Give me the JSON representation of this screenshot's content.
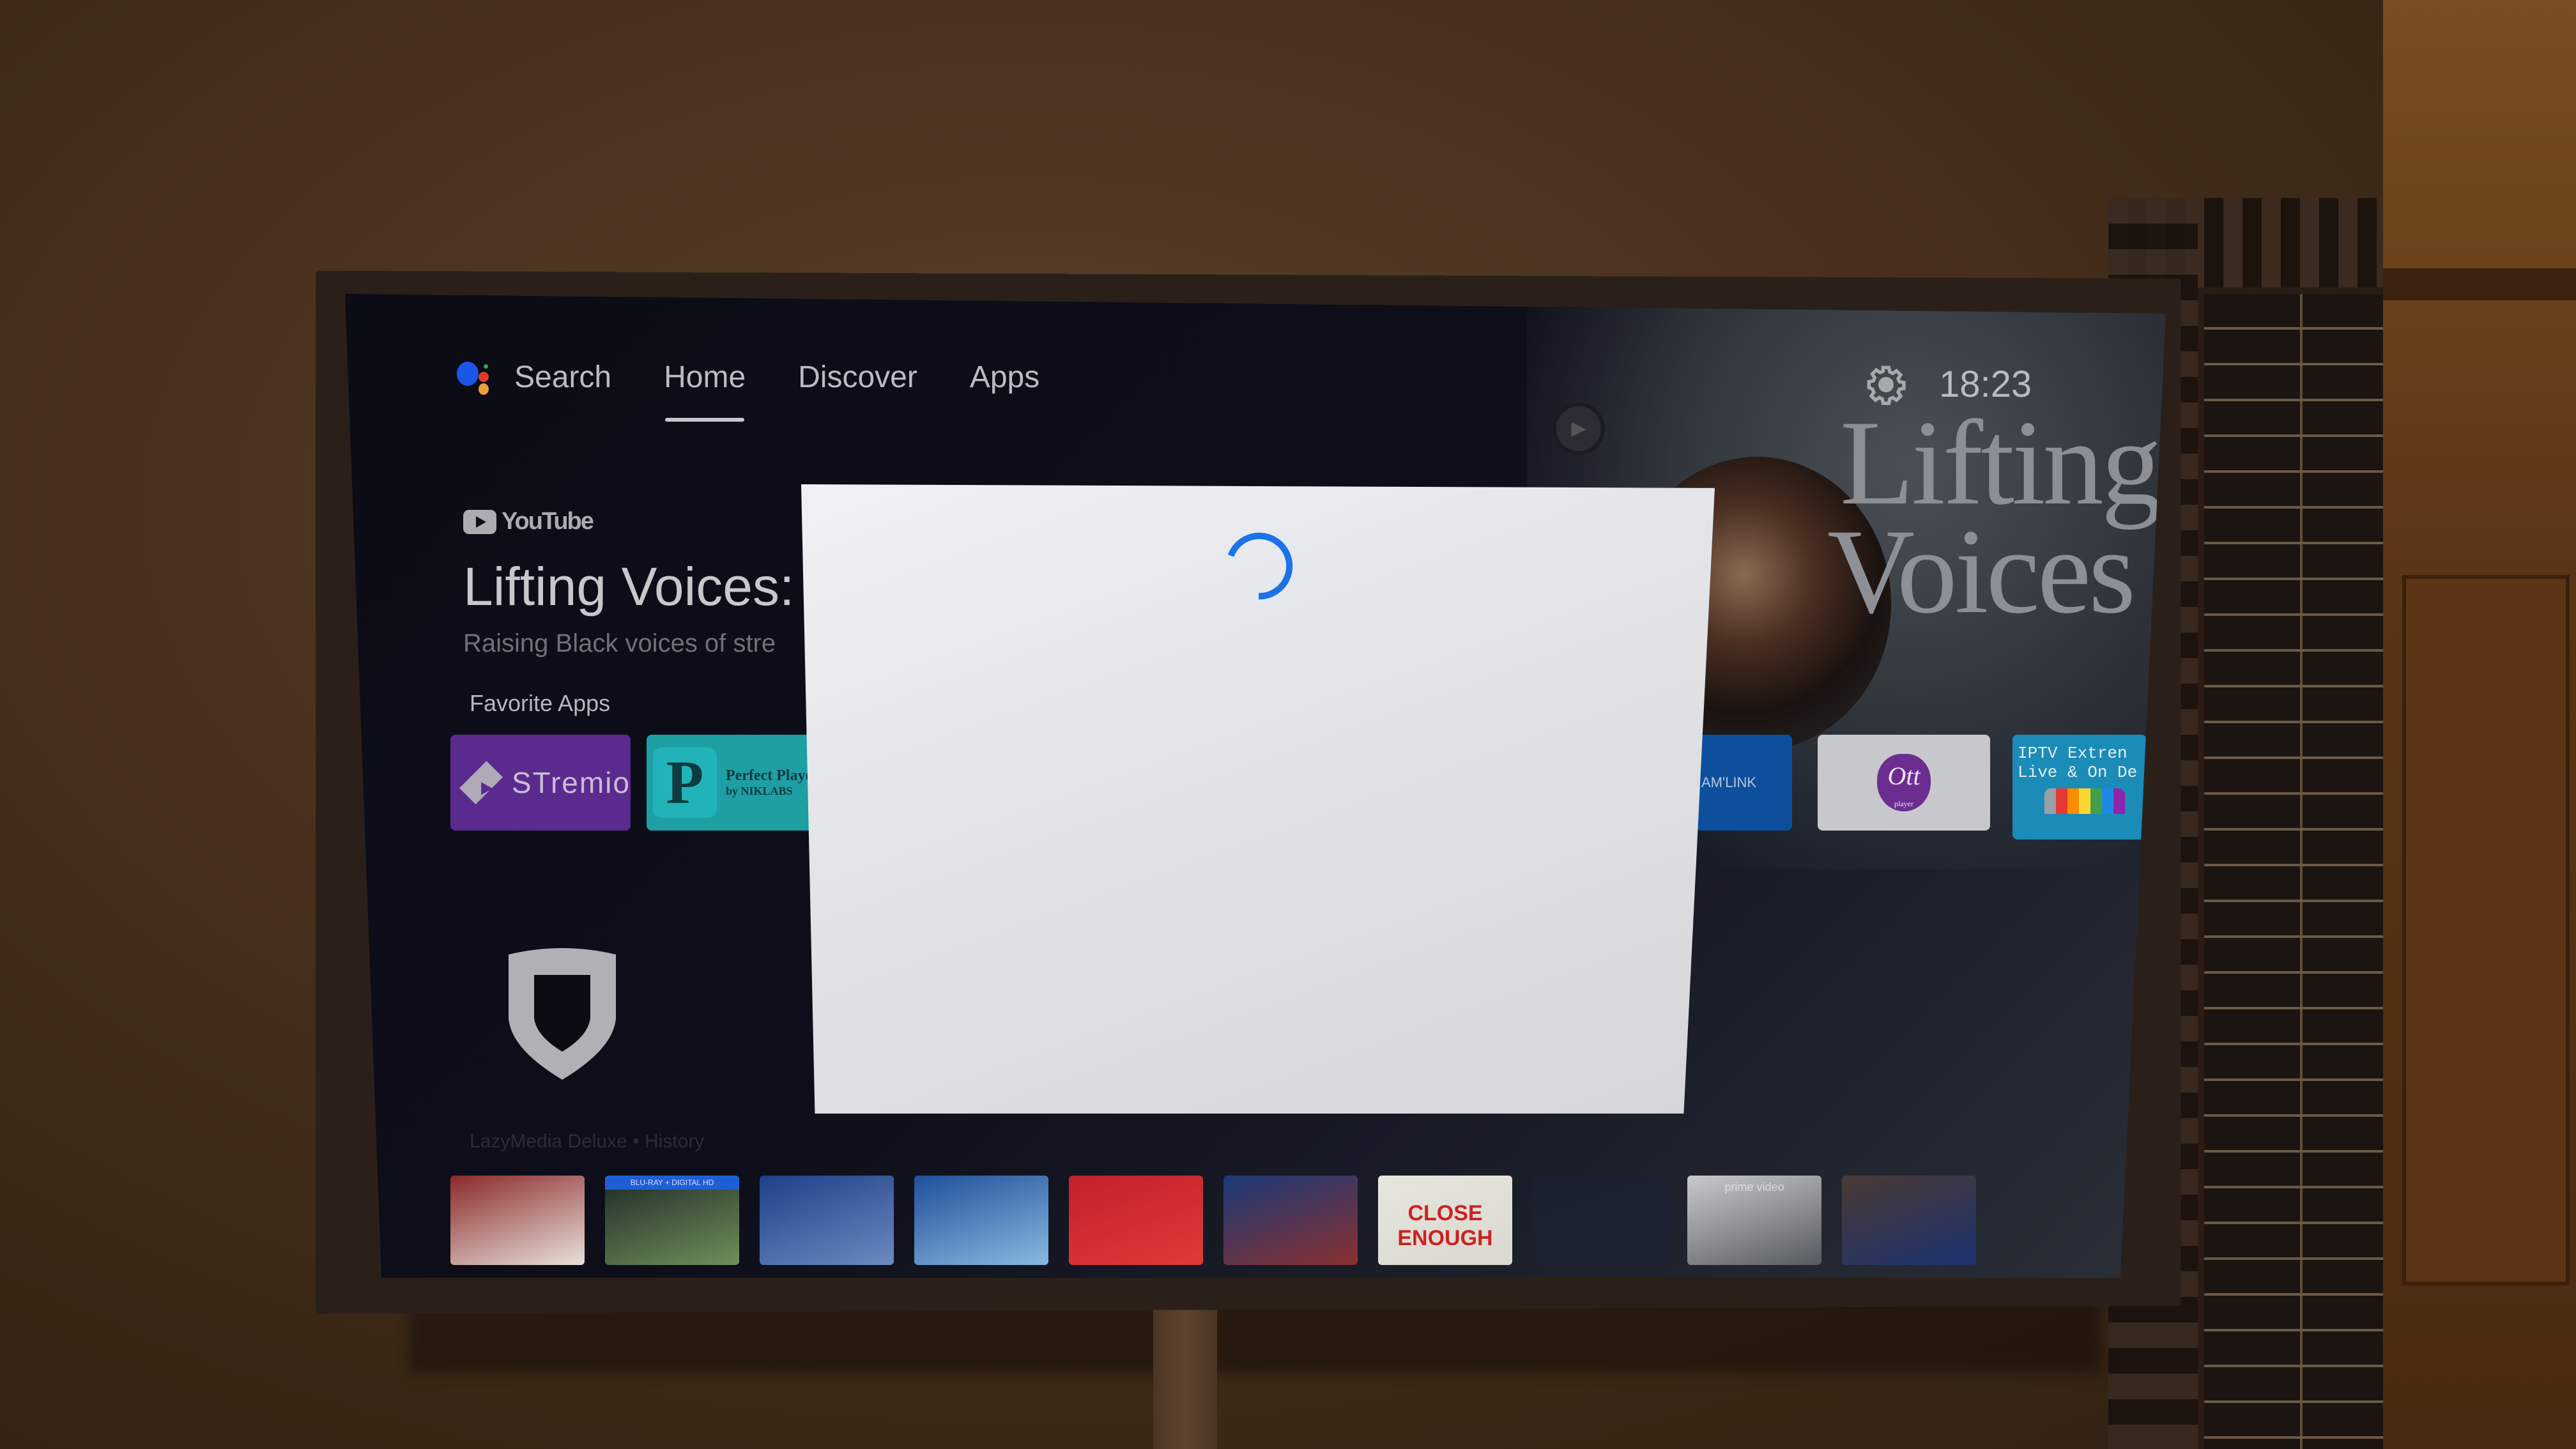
{
  "nav": {
    "search_label": "Search",
    "tabs": [
      {
        "label": "Home",
        "active": true
      },
      {
        "label": "Discover",
        "active": false
      },
      {
        "label": "Apps",
        "active": false
      }
    ],
    "settings_icon": "gear-icon",
    "clock": "18:23"
  },
  "hero": {
    "source": "YouTube",
    "title": "Lifting Voices:",
    "subtitle": "Raising Black voices of stre",
    "art_title_line1": "Lifting",
    "art_title_line2": "Voices"
  },
  "favorite_apps": {
    "title": "Favorite Apps",
    "items": [
      {
        "name": "Stremio",
        "label": "STremio",
        "color": "#5b2a8e"
      },
      {
        "name": "Perfect Player",
        "label_line1": "Perfect Player",
        "label_line2": "by NIKLABS",
        "icon_letter": "P",
        "color": "#1e9fa3"
      },
      {
        "name": "Steam Link",
        "label": "AM'LINK",
        "color": "#0d4f9c"
      },
      {
        "name": "OTT Player",
        "label": "Ott",
        "sublabel": "player",
        "color": "#c7c8cc"
      },
      {
        "name": "IPTV Extreme",
        "label_line1": "IPTV Extren",
        "label_line2": "Live & On De",
        "color": "#1b8bb8"
      }
    ]
  },
  "lazymedia": {
    "title": "LazyMedia Deluxe • History",
    "icon": "shield-icon",
    "posters": [
      {
        "name": "poster-1",
        "colors": [
          "#8a2a2a",
          "#e8e0da"
        ]
      },
      {
        "name": "poster-2",
        "badge": "BLU-RAY + DIGITAL HD",
        "colors": [
          "#1f2a28",
          "#6f8f5a"
        ]
      },
      {
        "name": "poster-3",
        "colors": [
          "#1f3f8a",
          "#6a8ac0"
        ]
      },
      {
        "name": "poster-4",
        "colors": [
          "#1f4f9a",
          "#8ab8e0"
        ]
      },
      {
        "name": "poster-5",
        "colors": [
          "#c3202a",
          "#e03a3a"
        ]
      },
      {
        "name": "poster-6",
        "colors": [
          "#1a3a78",
          "#8a3030"
        ]
      },
      {
        "name": "poster-7",
        "label": "CLOSE ENOUGH",
        "colors": [
          "#e6e6dc",
          "#d8d8d0"
        ]
      },
      {
        "name": "poster-8",
        "colors": [
          "#1a2030",
          "#1c2232"
        ]
      },
      {
        "name": "poster-9",
        "label": "prime video",
        "colors": [
          "#c8cacc",
          "#555a60"
        ]
      },
      {
        "name": "poster-10",
        "colors": [
          "#4a3a34",
          "#1c3270"
        ]
      }
    ]
  },
  "loading_dialog": {
    "state": "loading",
    "spinner_color": "#1a73e8"
  },
  "assistant_colors": [
    "#1a56e8",
    "#e0392c",
    "#e8a03a",
    "#2aa84a"
  ],
  "iptv_bar_colors": [
    "#9aa0a6",
    "#e53935",
    "#fb8c00",
    "#fdd835",
    "#43a047",
    "#1e88e5",
    "#8e24aa"
  ]
}
